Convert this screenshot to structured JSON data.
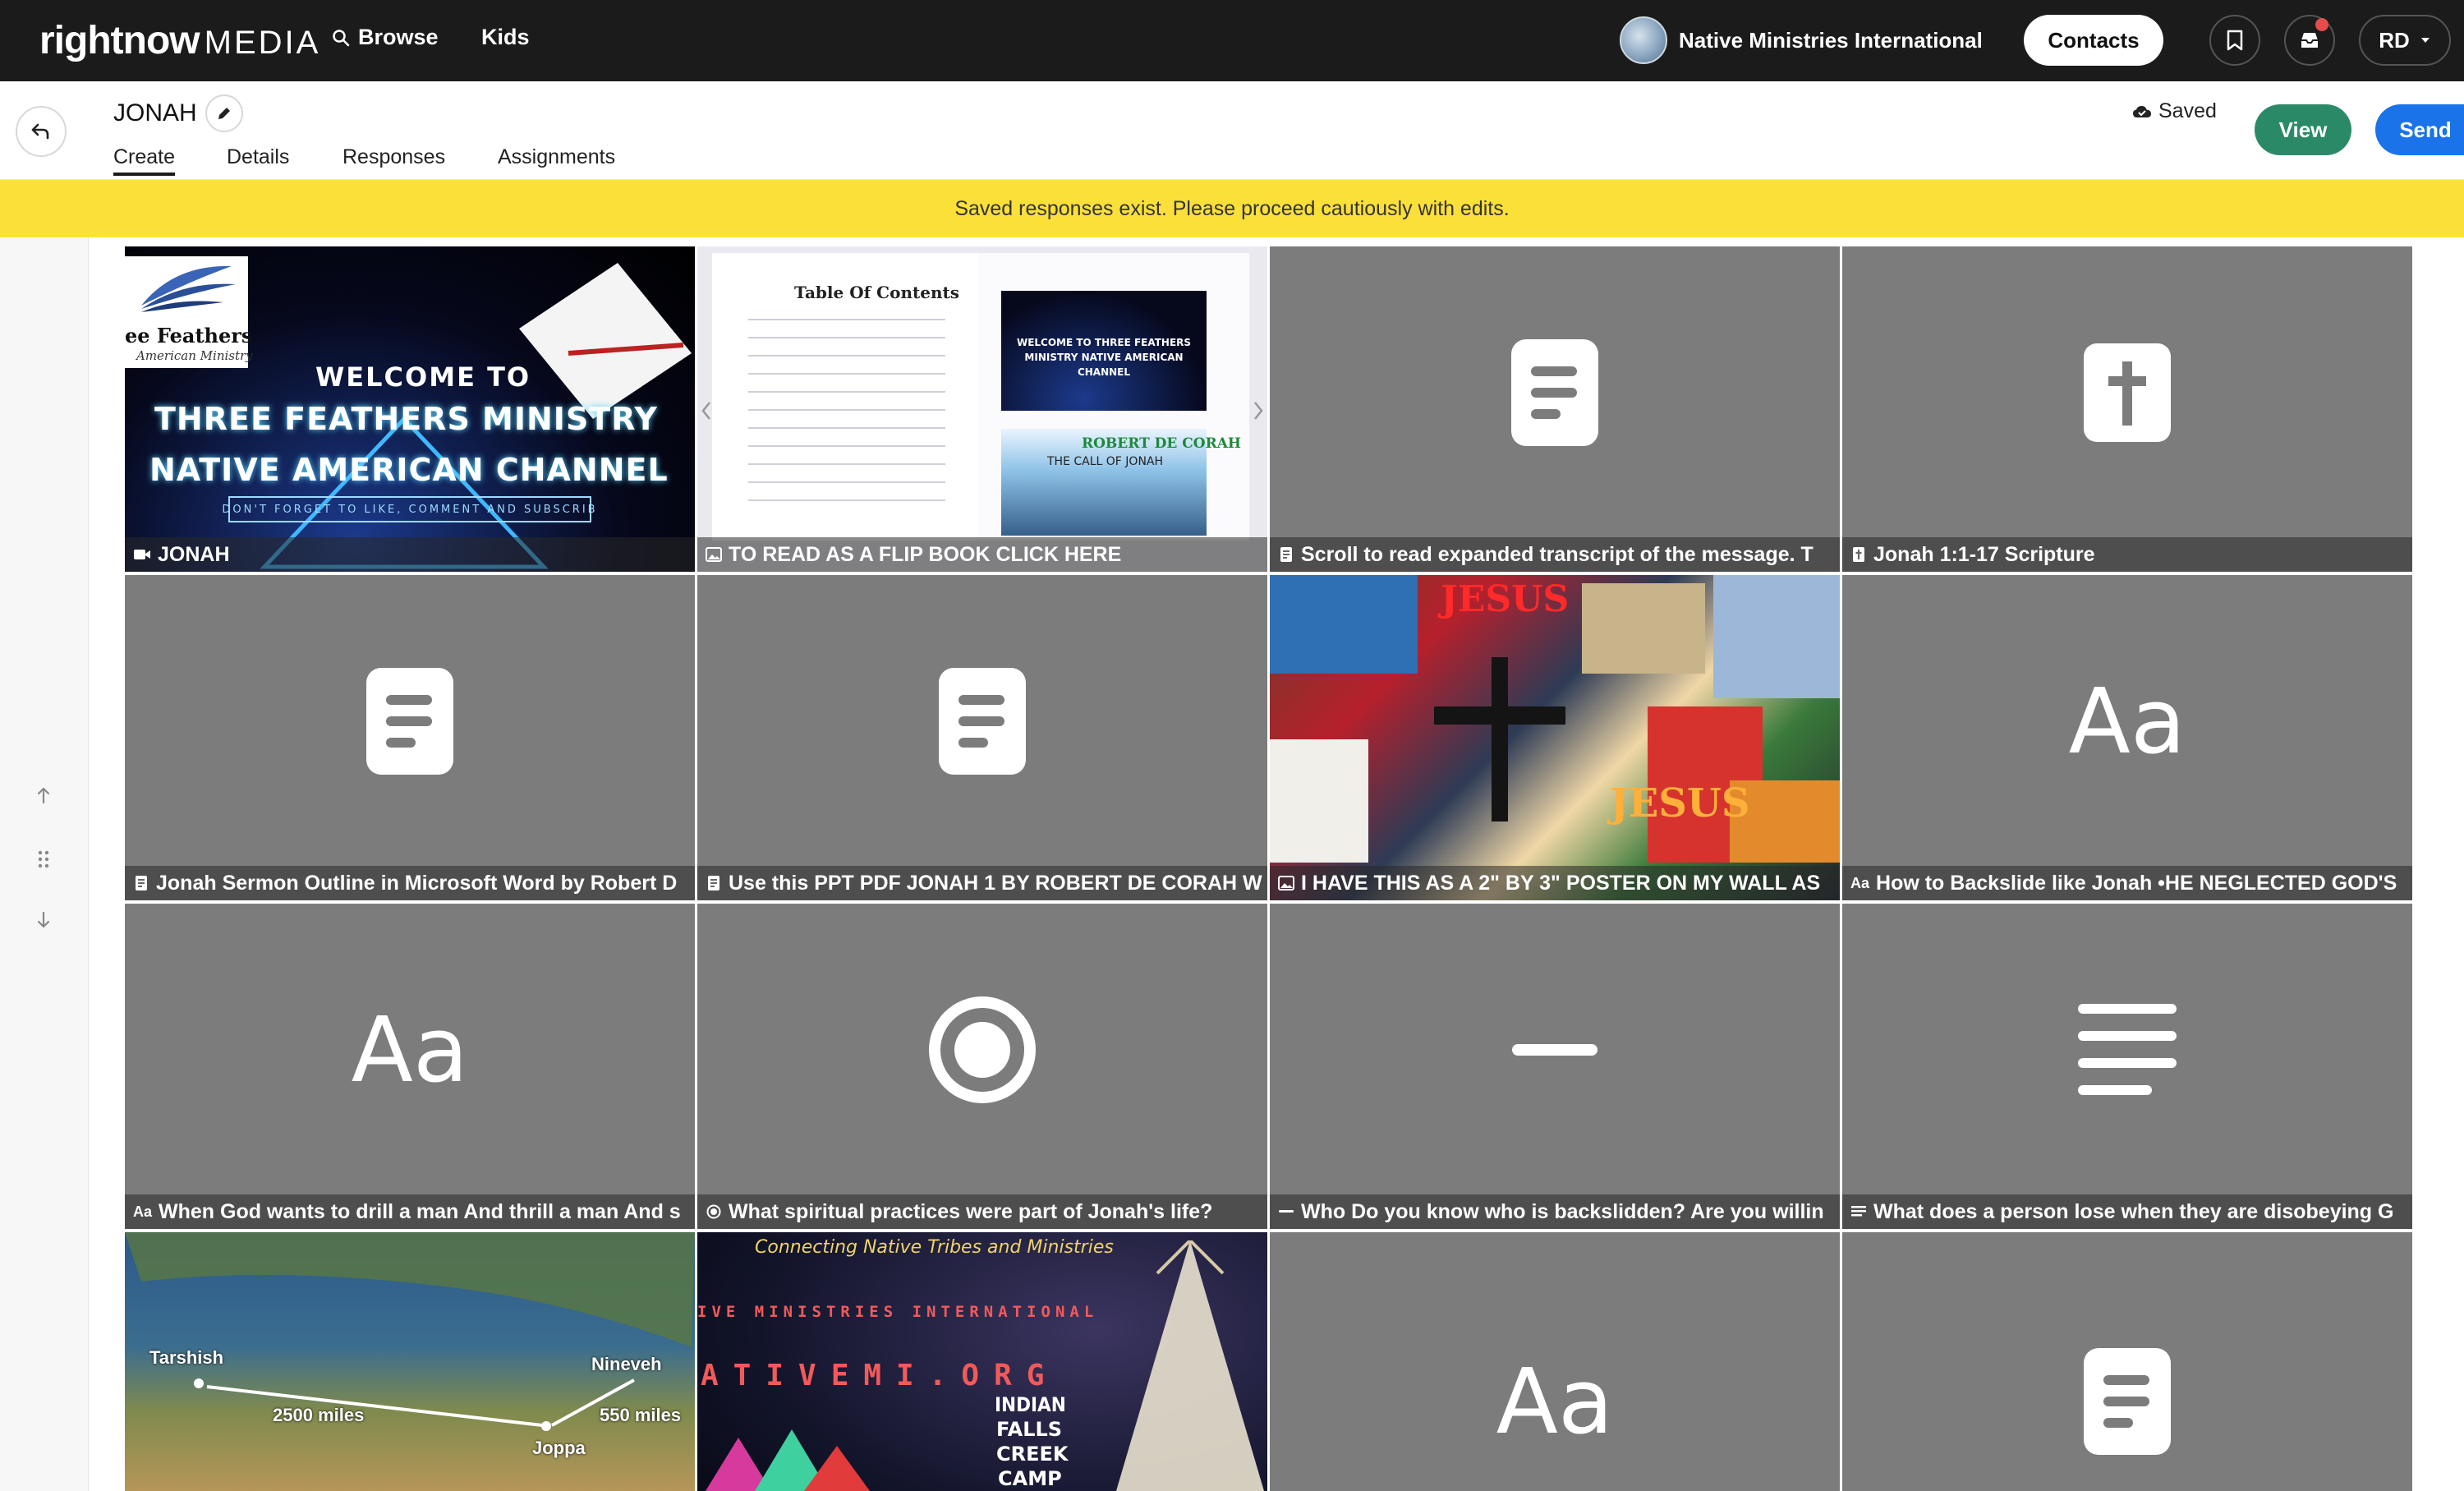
{
  "nav": {
    "logo_bold": "rightnow",
    "logo_light": "MEDIA",
    "browse": "Browse",
    "kids": "Kids",
    "org_name": "Native Ministries International",
    "contacts": "Contacts",
    "user_initials": "RD"
  },
  "header": {
    "title": "JONAH",
    "tabs": [
      "Create",
      "Details",
      "Responses",
      "Assignments"
    ],
    "saved_label": "Saved",
    "view_label": "View",
    "send_label": "Send"
  },
  "banner": {
    "message": "Saved responses exist. Please proceed cautiously with edits."
  },
  "tiles": [
    {
      "type": "image",
      "art": "welcome",
      "cap_icon": "video-icon",
      "caption": "JONAH",
      "art_text": {
        "brand": "ee Feathers",
        "brand_sub": "American Ministry",
        "line1": "WELCOME TO",
        "line2": "THREE FEATHERS MINISTRY",
        "line3": "NATIVE AMERICAN CHANNEL",
        "line4": "DON'T FORGET TO LIKE, COMMENT AND SUBSCRIB"
      }
    },
    {
      "type": "image",
      "art": "flip",
      "cap_icon": "image-icon",
      "caption": "TO READ AS A FLIP BOOK CLICK HERE",
      "art_text": {
        "toc": "Table Of Contents",
        "mini": "WELCOME TO THREE FEATHERS MINISTRY NATIVE AMERICAN CHANNEL",
        "author": "ROBERT DE CORAH",
        "book": "THE CALL OF JONAH"
      }
    },
    {
      "type": "doc",
      "cap_icon": "doc-icon",
      "caption": "Scroll to read expanded transcript of the message. T"
    },
    {
      "type": "bible",
      "cap_icon": "bible-icon",
      "caption": "Jonah 1:1-17 Scripture"
    },
    {
      "type": "doc",
      "cap_icon": "doc-icon",
      "caption": "Jonah Sermon Outline in Microsoft Word by Robert D"
    },
    {
      "type": "doc",
      "cap_icon": "doc-icon",
      "caption": "Use this PPT PDF JONAH 1 BY ROBERT DE CORAH W"
    },
    {
      "type": "image",
      "art": "collage",
      "cap_icon": "image-icon",
      "caption": "I HAVE THIS AS A 2\" BY 3\" POSTER ON MY WALL AS",
      "art_text": {
        "word1": "JESUS",
        "word2": "JESUS"
      }
    },
    {
      "type": "text",
      "cap_icon": "text-icon",
      "caption": "How to Backslide like Jonah •HE NEGLECTED GOD'S"
    },
    {
      "type": "text",
      "cap_icon": "text-icon",
      "caption": "When God wants to drill a man And thrill a man And s"
    },
    {
      "type": "radio",
      "cap_icon": "radio-icon",
      "caption": "What spiritual practices were part of Jonah's life?"
    },
    {
      "type": "short",
      "cap_icon": "short-answer-icon",
      "caption": "Who Do you know who is backslidden? Are you willin"
    },
    {
      "type": "long",
      "cap_icon": "long-answer-icon",
      "caption": "What does a person lose when they are disobeying G"
    },
    {
      "type": "image",
      "art": "map",
      "cap_icon": "",
      "caption": "",
      "art_text": {
        "tarshish": "Tarshish",
        "nineveh": "Nineveh",
        "joppa": "Joppa",
        "dist1": "2500 miles",
        "dist2": "550 miles"
      }
    },
    {
      "type": "image",
      "art": "native",
      "cap_icon": "",
      "caption": "",
      "art_text": {
        "tagline": "Connecting Native Tribes and Ministries",
        "line1": "IVE MINISTRIES INTERNATIONAL",
        "line2": "ATIVEMI.ORG",
        "line3": "INDIAN",
        "line4": "FALLS",
        "line5": "CREEK",
        "line6": "CAMP"
      }
    },
    {
      "type": "text",
      "cap_icon": "",
      "caption": ""
    },
    {
      "type": "doc",
      "cap_icon": "",
      "caption": ""
    }
  ],
  "text_icon_label": "Aa",
  "cap_text_icon_label": "Aa"
}
